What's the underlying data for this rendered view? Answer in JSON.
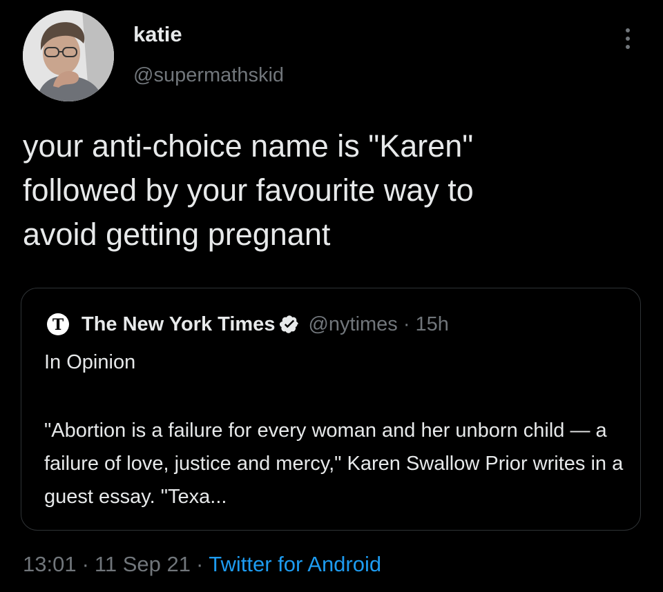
{
  "author": {
    "display_name": "katie",
    "handle": "@supermathskid",
    "avatar_icon": "profile-photo"
  },
  "tweet": {
    "text": "your anti-choice name is \"Karen\"\nfollowed by your favourite way to\navoid getting pregnant"
  },
  "quoted_tweet": {
    "display_name": "The New York Times",
    "handle": "@nytimes",
    "separator": "·",
    "time": "15h",
    "verified": true,
    "logo_icon": "nyt-logo-icon",
    "subline": "In Opinion",
    "body": "\"Abortion is a failure for every woman and her unborn child — a failure of love, justice and mercy,\" Karen Swallow Prior writes in a guest essay. \"Texa..."
  },
  "meta": {
    "time": "13:01",
    "separator": "·",
    "date": "11 Sep 21",
    "source": "Twitter for Android"
  },
  "colors": {
    "background": "#000000",
    "text": "#e7e9ea",
    "secondary": "#71767b",
    "link": "#1d9bf0",
    "border": "#2f3336"
  }
}
